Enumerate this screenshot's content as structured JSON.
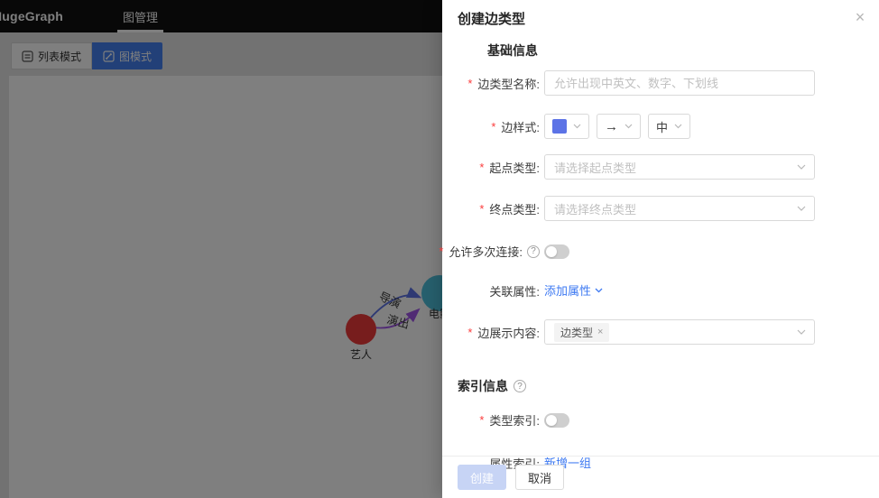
{
  "header": {
    "logo": "HugeGraph",
    "tab": "图管理"
  },
  "toolbar": {
    "list_mode": "列表模式",
    "graph_mode": "图模式"
  },
  "graph": {
    "nodes": [
      {
        "label": "艺人",
        "color": "#ee3b3b"
      },
      {
        "label": "电影",
        "color": "#4fc0dd"
      }
    ],
    "edges": [
      {
        "label": "导演",
        "color": "#5c73e6"
      },
      {
        "label": "演出",
        "color": "#a155e8"
      }
    ]
  },
  "drawer": {
    "title": "创建边类型",
    "required_mark": "*",
    "basic_section": "基础信息",
    "index_section": "索引信息",
    "fields": {
      "name": {
        "label": "边类型名称:",
        "placeholder": "允许出现中英文、数字、下划线"
      },
      "style": {
        "label": "边样式:",
        "color": "#5c73e6",
        "arrow": "→",
        "thickness": "中"
      },
      "source": {
        "label": "起点类型:",
        "placeholder": "请选择起点类型"
      },
      "target": {
        "label": "终点类型:",
        "placeholder": "请选择终点类型"
      },
      "multi": {
        "label": "允许多次连接:",
        "state": "off"
      },
      "assoc": {
        "label": "关联属性:",
        "link": "添加属性"
      },
      "display": {
        "label": "边展示内容:",
        "tag": "边类型"
      },
      "type_index": {
        "label": "类型索引:",
        "state": "off"
      },
      "prop_index": {
        "label": "属性索引:",
        "link": "新增一组"
      }
    },
    "footer": {
      "create": "创建",
      "cancel": "取消"
    },
    "icons": {
      "close": "×",
      "help": "?",
      "tag_remove": "×"
    }
  }
}
